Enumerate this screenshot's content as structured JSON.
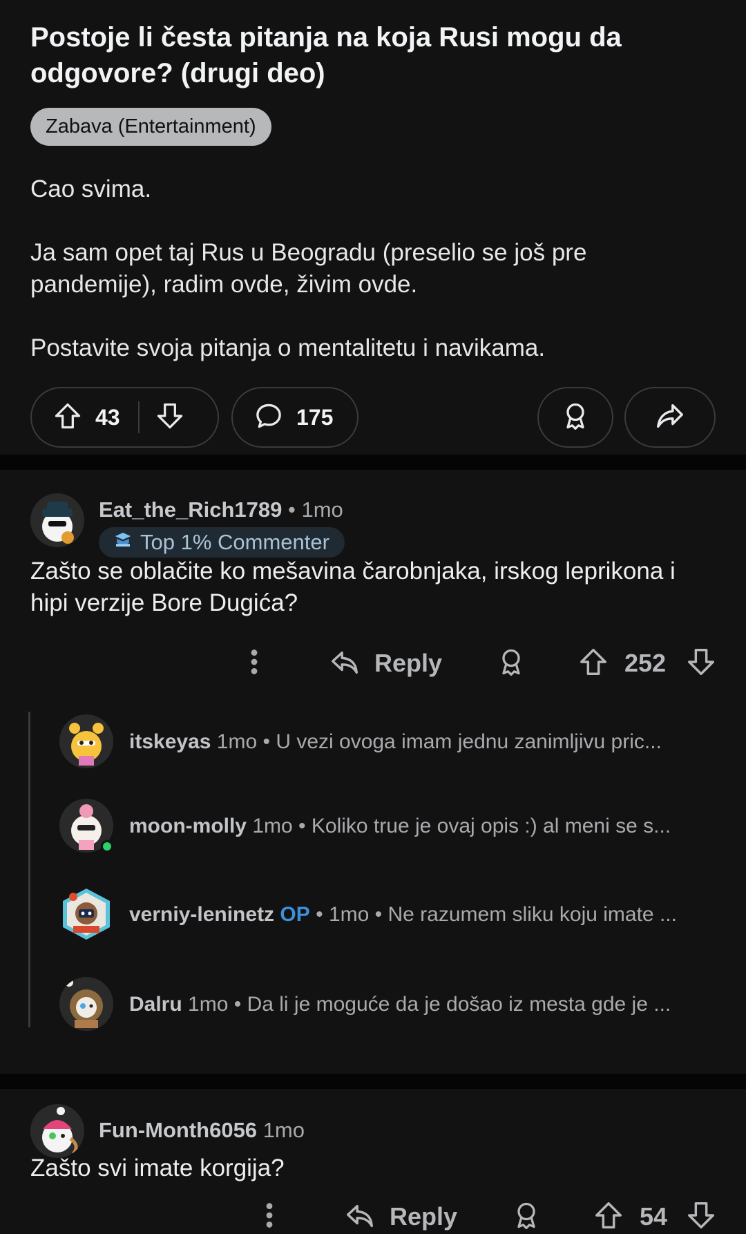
{
  "post": {
    "title": "Postoje li česta pitanja na koja Rusi mogu da odgovore? (drugi deo)",
    "flair": "Zabava (Entertainment)",
    "body": [
      "Cao svima.",
      "Ja sam opet taj Rus u Beogradu (preselio se još pre pandemije), radim ovde, živim ovde.",
      "Postavite svoja pitanja o mentalitetu i navikama."
    ],
    "upvotes": "43",
    "comments": "175"
  },
  "comments": [
    {
      "username": "Eat_the_Rich1789",
      "time": "• 1mo",
      "badge": "Top 1% Commenter",
      "text": "Zašto se oblačite ko mešavina čarobnjaka, irskog leprikona i hipi verzije Bore Dugića?",
      "reply_label": "Reply",
      "score": "252",
      "replies": [
        {
          "username": "itskeyas",
          "time": "1mo",
          "preview": "• U vezi ovoga imam jednu zanimljivu pric..."
        },
        {
          "username": "moon-molly",
          "time": "1mo",
          "preview": "• Koliko true je ovaj opis :) al meni se s..."
        },
        {
          "username": "verniy-leninetz",
          "op": "OP",
          "time": "• 1mo",
          "preview": "• Ne razumem sliku koju imate ..."
        },
        {
          "username": "Dalru",
          "time": "1mo",
          "preview": "• Da li je moguće da je došao iz mesta gde je ..."
        }
      ]
    },
    {
      "username": "Fun-Month6056",
      "time": "1mo",
      "text": "Zašto svi imate korgija?",
      "reply_label": "Reply",
      "score": "54"
    }
  ],
  "colors": {
    "background": "#121212",
    "op": "#3d8fd8",
    "online": "#2bd26b"
  }
}
